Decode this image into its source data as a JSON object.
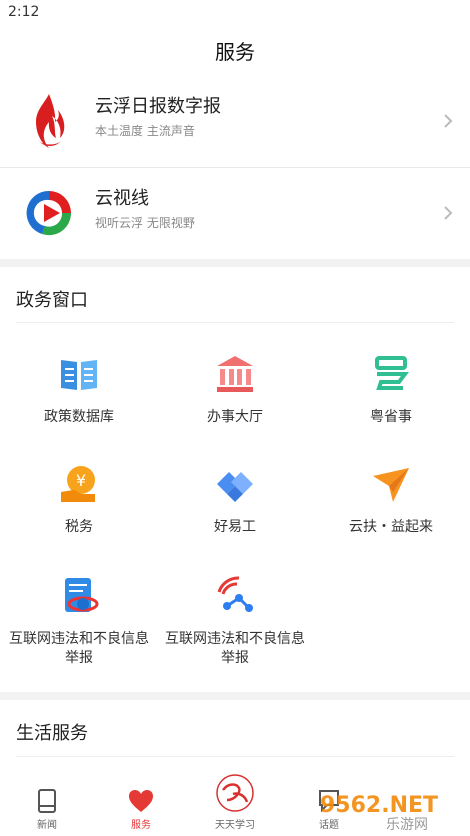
{
  "status": {
    "time": "2:12"
  },
  "page": {
    "title": "服务"
  },
  "apps": [
    {
      "name": "云浮日报数字报",
      "subtitle": "本土温度  主流声音"
    },
    {
      "name": "云视线",
      "subtitle": "视听云浮  无限视野"
    }
  ],
  "gov": {
    "title": "政务窗口",
    "items": [
      {
        "label": "政策数据库",
        "icon": "book-icon"
      },
      {
        "label": "办事大厅",
        "icon": "government-building-icon"
      },
      {
        "label": "粤省事",
        "icon": "yue-icon"
      },
      {
        "label": "税务",
        "icon": "yuan-coin-icon"
      },
      {
        "label": "好易工",
        "icon": "handshake-icon"
      },
      {
        "label": "云扶・益起来",
        "icon": "paper-plane-icon"
      },
      {
        "label": "互联网违法和不良信息举报",
        "icon": "report-document-icon"
      },
      {
        "label": "互联网违法和不良信息举报",
        "icon": "signal-report-icon"
      }
    ]
  },
  "life": {
    "title": "生活服务"
  },
  "tabs": [
    {
      "label": "新闻",
      "icon": "news-icon",
      "active": false
    },
    {
      "label": "服务",
      "icon": "heart-icon",
      "active": true
    },
    {
      "label": "天天学习",
      "icon": "xuexi-icon",
      "active": false
    },
    {
      "label": "话题",
      "icon": "topic-icon",
      "active": false
    }
  ],
  "watermark": {
    "text": "9562.NET",
    "subtext": "乐游网"
  }
}
